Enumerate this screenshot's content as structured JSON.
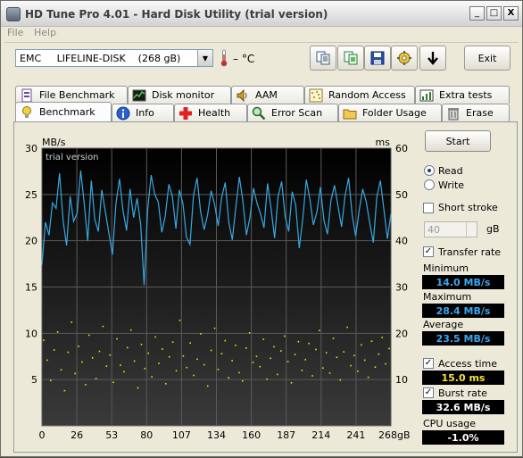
{
  "window": {
    "title": "HD Tune Pro 4.01 - Hard Disk Utility (trial version)",
    "minimize": "_",
    "maximize": "□",
    "close": "X"
  },
  "menu": {
    "file": "File",
    "help": "Help"
  },
  "toolbar": {
    "drive": "EMC     LIFELINE-DISK    (268 gB)",
    "drive_dropdown": "▼",
    "temperature": "– °C",
    "exit": "Exit",
    "buttons": [
      "copy-text-icon",
      "copy-screenshot-icon",
      "save-icon",
      "options-icon",
      "down-arrow-icon"
    ]
  },
  "tabs": {
    "row1": [
      "File Benchmark",
      "Disk monitor",
      "AAM",
      "Random Access",
      "Extra tests"
    ],
    "row2": [
      "Benchmark",
      "Info",
      "Health",
      "Error Scan",
      "Folder Usage",
      "Erase"
    ],
    "active": "Benchmark"
  },
  "benchmark": {
    "start": "Start",
    "read": "Read",
    "write": "Write",
    "mode": "Read",
    "short_stroke": "Short stroke",
    "short_stroke_checked": false,
    "short_stroke_value": "40",
    "short_stroke_unit": "gB",
    "transfer_rate": "Transfer rate",
    "transfer_rate_checked": true,
    "minimum_label": "Minimum",
    "minimum": "14.0 MB/s",
    "maximum_label": "Maximum",
    "maximum": "28.4 MB/s",
    "average_label": "Average",
    "average": "23.5 MB/s",
    "access_time": "Access time",
    "access_time_checked": true,
    "access_time_value": "15.0 ms",
    "burst_rate": "Burst rate",
    "burst_rate_checked": true,
    "burst_rate_value": "32.6 MB/s",
    "cpu_usage_label": "CPU usage",
    "cpu_usage": "-1.0%"
  },
  "chart_data": {
    "type": "line",
    "watermark": "trial version",
    "y_left_label": "MB/s",
    "y_right_label": "ms",
    "y_left_ticks": [
      "30",
      "25",
      "20",
      "15",
      "10",
      "5"
    ],
    "y_right_ticks": [
      "60",
      "50",
      "40",
      "30",
      "20",
      "10"
    ],
    "x_ticks": [
      "0",
      "26",
      "53",
      "80",
      "107",
      "134",
      "160",
      "187",
      "214",
      "241",
      "268gB"
    ],
    "ylim_left": [
      0,
      30
    ],
    "ylim_right": [
      0,
      60
    ],
    "xlim": [
      0,
      268
    ],
    "series_color": "#38a8e0",
    "access_color": "#e8e600",
    "transfer_rate": [
      17.4,
      22.0,
      20.6,
      24.1,
      23.5,
      27.3,
      22.2,
      19.5,
      24.8,
      22.1,
      23.0,
      27.6,
      24.0,
      20.0,
      26.5,
      22.3,
      21.0,
      25.5,
      23.1,
      20.8,
      18.5,
      24.0,
      26.7,
      23.3,
      21.1,
      25.6,
      22.5,
      24.6,
      21.8,
      15.2,
      23.4,
      27.1,
      25.0,
      24.2,
      20.9,
      22.7,
      26.1,
      24.8,
      21.3,
      25.5,
      24.0,
      20.4,
      19.6,
      24.9,
      26.8,
      23.2,
      21.2,
      22.8,
      25.4,
      23.9,
      21.6,
      24.7,
      26.3,
      22.0,
      20.1,
      23.6,
      26.9,
      24.3,
      20.6,
      22.5,
      25.7,
      24.1,
      22.9,
      21.4,
      26.2,
      23.5,
      20.3,
      24.8,
      26.4,
      22.6,
      21.0,
      25.3,
      23.8,
      19.2,
      22.4,
      26.6,
      24.5,
      21.7,
      23.1,
      25.8,
      22.2,
      20.7,
      24.4,
      26.0,
      23.7,
      21.5,
      24.9,
      26.8,
      22.8,
      20.5,
      23.3,
      25.6,
      24.2,
      21.9,
      19.8,
      24.7,
      26.5,
      23.4,
      20.2,
      22.9
    ],
    "access_time_ms": [
      18.5,
      14.2,
      9.8,
      16.4,
      20.3,
      12.1,
      7.6,
      15.9,
      22.4,
      11.3,
      17.2,
      13.8,
      8.9,
      19.6,
      14.7,
      10.2,
      16.1,
      21.5,
      12.9,
      15.3,
      9.4,
      18.8,
      13.1,
      11.7,
      16.9,
      20.7,
      14.0,
      8.2,
      17.6,
      12.4,
      15.7,
      10.6,
      19.2,
      13.5,
      16.6,
      9.1,
      14.9,
      18.1,
      11.9,
      22.8,
      15.1,
      12.6,
      17.9,
      10.9,
      14.4,
      19.9,
      13.2,
      8.6,
      16.3,
      21.1,
      12.2,
      15.6,
      18.4,
      10.4,
      14.1,
      17.4,
      11.5,
      9.7,
      16.8,
      20.1,
      13.7,
      15.0,
      12.8,
      18.7,
      10.1,
      14.6,
      17.1,
      11.1,
      16.2,
      19.4,
      13.9,
      9.3,
      15.4,
      18.2,
      12.0,
      14.3,
      17.8,
      10.8,
      16.5,
      20.6,
      12.5,
      15.8,
      11.4,
      18.9,
      14.8,
      9.9,
      16.0,
      21.3,
      13.0,
      15.2,
      11.8,
      17.5,
      14.2,
      10.5,
      18.3,
      12.7,
      15.5,
      19.1,
      13.4,
      16.7
    ]
  }
}
